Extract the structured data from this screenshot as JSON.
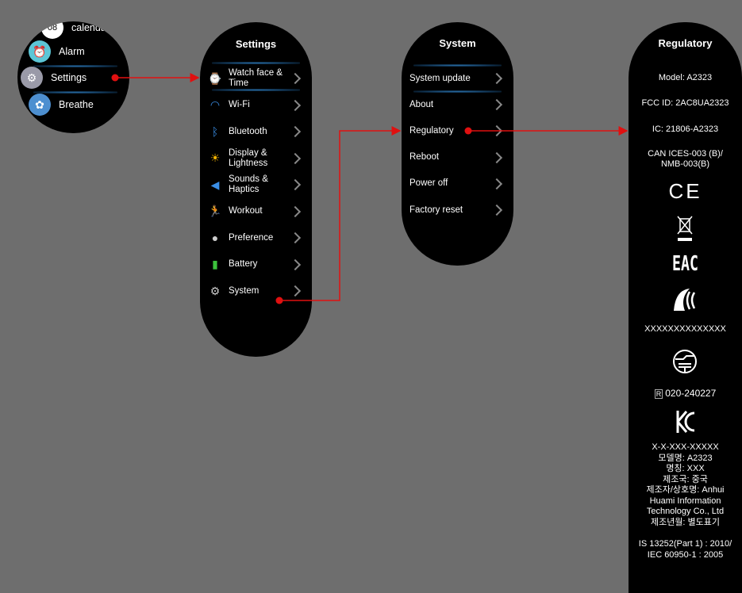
{
  "launcher": {
    "items": [
      {
        "label": "calendar",
        "icon": "calendar-icon",
        "badge": "08"
      },
      {
        "label": "Alarm",
        "icon": "alarm-icon"
      },
      {
        "label": "Settings",
        "icon": "gear-icon"
      },
      {
        "label": "Breathe",
        "icon": "breathe-icon"
      }
    ]
  },
  "settings": {
    "title": "Settings",
    "items": [
      {
        "label": "Watch face & Time",
        "icon": "watch-icon",
        "color": "#cccccc"
      },
      {
        "label": "Wi-Fi",
        "icon": "wifi-icon",
        "color": "#3a8ee6"
      },
      {
        "label": "Bluetooth",
        "icon": "bluetooth-icon",
        "color": "#3a8ee6"
      },
      {
        "label": "Display & Lightness",
        "icon": "sun-icon",
        "color": "#f5b400"
      },
      {
        "label": "Sounds & Haptics",
        "icon": "speaker-icon",
        "color": "#3a8ee6"
      },
      {
        "label": "Workout",
        "icon": "running-icon",
        "color": "#e53935"
      },
      {
        "label": "Preference",
        "icon": "person-icon",
        "color": "#cccccc"
      },
      {
        "label": "Battery",
        "icon": "battery-icon",
        "color": "#3cc23c"
      },
      {
        "label": "System",
        "icon": "gear-icon",
        "color": "#cccccc"
      }
    ]
  },
  "system": {
    "title": "System",
    "items": [
      "System update",
      "About",
      "Regulatory",
      "Reboot",
      "Power off",
      "Factory reset"
    ]
  },
  "regulatory": {
    "title": "Regulatory",
    "model": "Model: A2323",
    "fcc": "FCC ID: 2AC8UA2323",
    "ic": "IC: 21806-A2323",
    "ices": "CAN ICES-003 (B)/",
    "nmb": "NMB-003(B)",
    "ce": "CE",
    "eac": "EAC",
    "ncc_code": "XXXXXXXXXXXXXX",
    "telec": "020-240227",
    "telec_mark": "R",
    "kc_lines": [
      "X-X-XXX-XXXXX",
      "모델명: A2323",
      "명칭: XXX",
      "제조국: 중국",
      "제조자/상호명: Anhui",
      "Huami Information",
      "Technology Co., Ltd",
      "제조년월: 별도표기"
    ],
    "is_lines": [
      "IS 13252(Part 1) : 2010/",
      "IEC 60950-1 : 2005"
    ]
  },
  "colors": {
    "arrow": "#e01010",
    "background": "#6e6e6e"
  }
}
